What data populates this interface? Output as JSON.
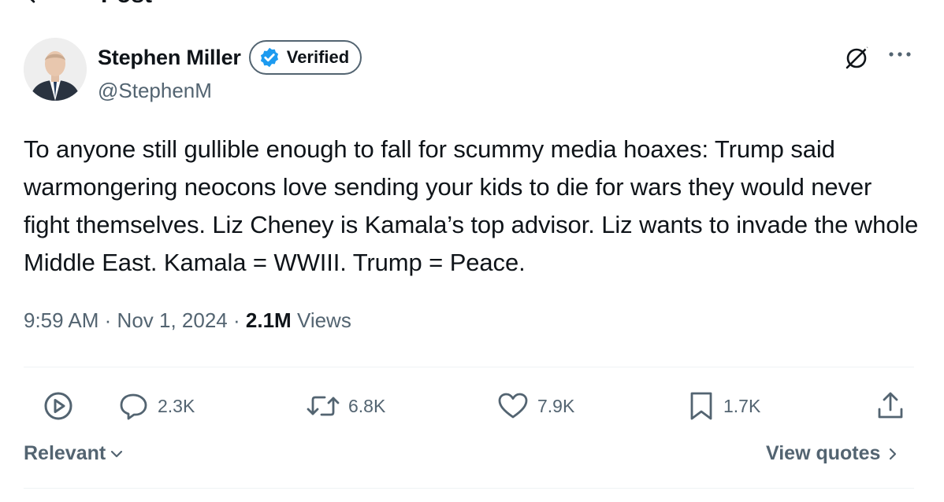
{
  "header": {
    "title": "Post"
  },
  "tweet": {
    "author": {
      "name": "Stephen Miller",
      "handle": "@StephenM",
      "verified_label": "Verified"
    },
    "text": "To anyone still gullible enough to fall for scummy media hoaxes: Trump said warmongering neocons love sending your kids to die for wars they would never fight themselves. Liz Cheney is Kamala’s top advisor. Liz wants to invade the whole Middle East. Kamala = WWIII. Trump = Peace.",
    "time": "9:59 AM",
    "date": "Nov 1, 2024",
    "views_count": "2.1M",
    "views_label": "Views",
    "separator": "·"
  },
  "actions": {
    "replies": "2.3K",
    "reposts": "6.8K",
    "likes": "7.9K",
    "bookmarks": "1.7K"
  },
  "replies_section": {
    "sort_label": "Relevant",
    "view_quotes_label": "View quotes"
  },
  "colors": {
    "text_primary": "#0f1419",
    "text_secondary": "#536471",
    "verified_blue": "#1d9bf0",
    "divider": "#eff3f4"
  },
  "icons": {
    "back": "arrow-left-icon",
    "grok": "grok-icon",
    "more": "more-horizontal-icon",
    "play": "play-circle-icon",
    "reply": "reply-icon",
    "repost": "repost-icon",
    "like": "heart-icon",
    "bookmark": "bookmark-icon",
    "share": "share-icon",
    "sort_chevron": "chevron-down-icon",
    "quotes_chevron": "chevron-right-icon"
  }
}
